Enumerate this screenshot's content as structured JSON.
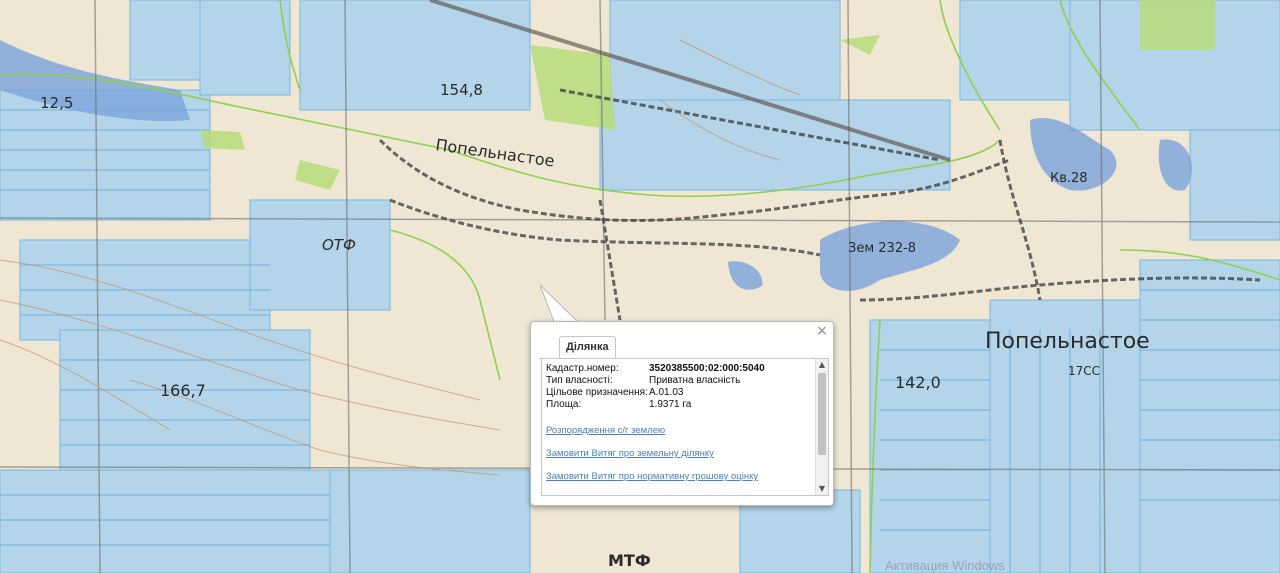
{
  "map": {
    "settlement_labels": [
      "Попельнастое",
      "Попельнастое"
    ],
    "elevation_labels": [
      "154,8",
      "166,7",
      "142,0",
      "12,5"
    ],
    "feature_labels": [
      "ОТФ",
      "Зем 232-8",
      "МТФ",
      "17СС",
      "Кв.28"
    ],
    "colors": {
      "parcel_fill": "#aed4ec",
      "parcel_stroke": "#6bb3e4",
      "boundary": "#8fd14f",
      "water": "#7aa4db",
      "green": "#b7dc7a"
    }
  },
  "popup": {
    "tab_label": "Ділянка",
    "close_symbol": "×",
    "fields": [
      {
        "label": "Кадастр.номер:",
        "value": "3520385500:02:000:5040"
      },
      {
        "label": "Тип власності:",
        "value": "Приватна власність"
      },
      {
        "label": "Цільове призначення:",
        "value": "A.01.03"
      },
      {
        "label": "Площа:",
        "value": "1.9371 га"
      }
    ],
    "links": [
      "Розпорядження с/г землею",
      "Замовити Витяг про земельну ділянку",
      "Замовити Витяг про нормативну грошову оцінку"
    ]
  },
  "watermark": "Активация Windows"
}
